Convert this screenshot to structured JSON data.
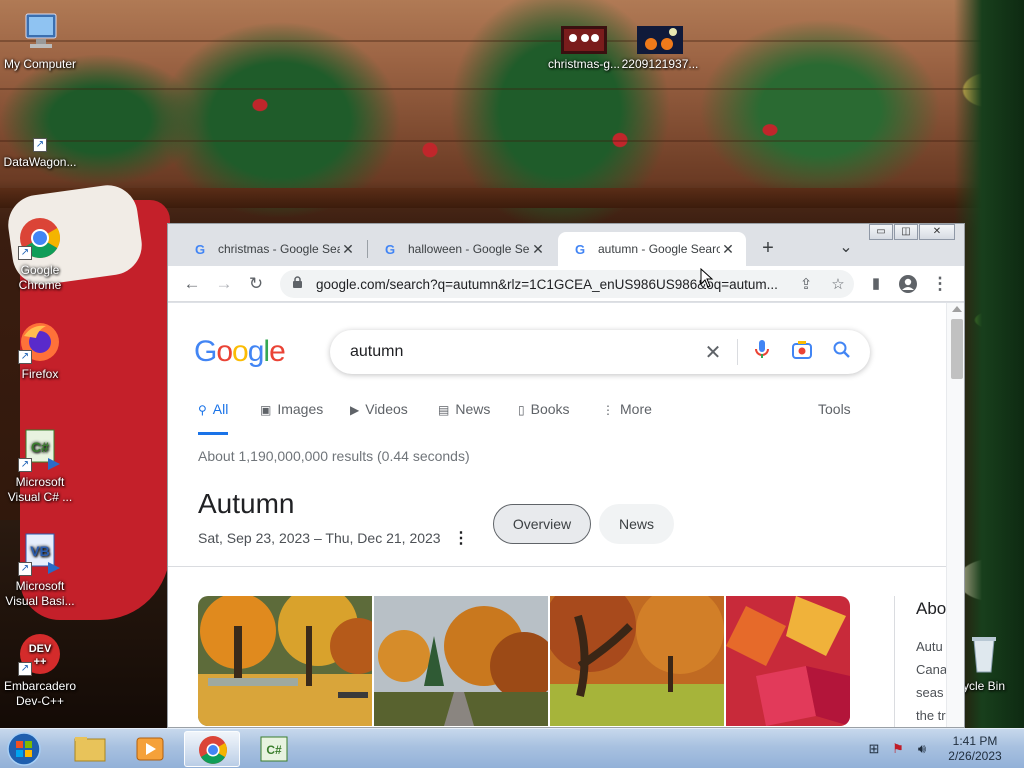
{
  "desktop": {
    "icons": [
      {
        "label": "My Computer"
      },
      {
        "label": "DataWagon..."
      },
      {
        "label": "Google Chrome"
      },
      {
        "label": "Firefox"
      },
      {
        "label": "Microsoft Visual C# ..."
      },
      {
        "label": "Microsoft Visual Basi..."
      },
      {
        "label": "Embarcadero Dev-C++"
      },
      {
        "label": "christmas-g..."
      },
      {
        "label": "2209121937..."
      },
      {
        "label": "ycle Bin"
      }
    ],
    "dev_badge": "DEV\n++",
    "cs_badge": "C#",
    "vb_badge": "VB"
  },
  "browser": {
    "tabs": [
      {
        "title": "christmas - Google Search",
        "active": false
      },
      {
        "title": "halloween - Google Search",
        "active": false
      },
      {
        "title": "autumn - Google Search",
        "active": true
      }
    ],
    "new_tab_label": "+",
    "tab_search_label": "⌄",
    "url": "google.com/search?q=autumn&rlz=1C1GCEA_enUS986US986&oq=autum...",
    "window_controls": {
      "minimize": "▭",
      "maximize": "◫",
      "close": "✕"
    }
  },
  "google": {
    "logo_letters": [
      {
        "ch": "G",
        "color": "#4285F4"
      },
      {
        "ch": "o",
        "color": "#EA4335"
      },
      {
        "ch": "o",
        "color": "#FBBC05"
      },
      {
        "ch": "g",
        "color": "#4285F4"
      },
      {
        "ch": "l",
        "color": "#34A853"
      },
      {
        "ch": "e",
        "color": "#EA4335"
      }
    ],
    "query": "autumn",
    "nav_tabs": [
      {
        "label": "All",
        "icon": "search-icon",
        "active": true
      },
      {
        "label": "Images",
        "icon": "image-icon",
        "active": false
      },
      {
        "label": "Videos",
        "icon": "play-icon",
        "active": false
      },
      {
        "label": "News",
        "icon": "news-icon",
        "active": false
      },
      {
        "label": "Books",
        "icon": "book-icon",
        "active": false
      },
      {
        "label": "More",
        "icon": "more-vert-icon",
        "active": false
      }
    ],
    "tools_label": "Tools",
    "result_stats": "About 1,190,000,000 results (0.44 seconds)",
    "knowledge_panel": {
      "title": "Autumn",
      "subtitle": "Sat, Sep 23, 2023 – Thu, Dec 21, 2023",
      "chips": [
        {
          "label": "Overview",
          "selected": true
        },
        {
          "label": "News",
          "selected": false
        }
      ],
      "side_title": "Abo",
      "side_lines": [
        "Autu",
        "Cana",
        "seas",
        "the tr"
      ]
    }
  },
  "taskbar": {
    "clock_time": "1:41 PM",
    "clock_date": "2/26/2023",
    "cs_label": "C#"
  },
  "colors": {
    "google_blue": "#1a73e8",
    "chrome_frame": "#dee1e6",
    "taskbar": "#a8c1e0"
  }
}
